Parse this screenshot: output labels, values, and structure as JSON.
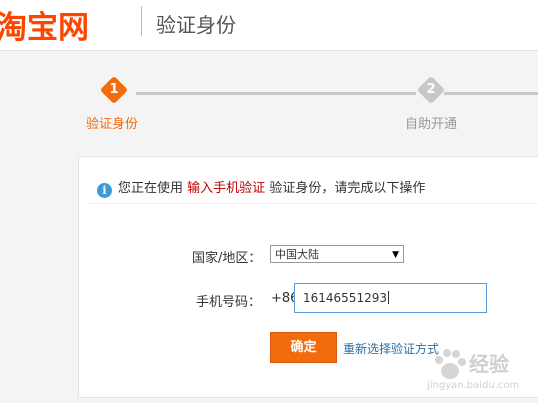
{
  "header": {
    "logo": "淘宝网",
    "title": "验证身份"
  },
  "steps": [
    {
      "number": "1",
      "label": "验证身份",
      "state": "active"
    },
    {
      "number": "2",
      "label": "自助开通",
      "state": "inactive"
    }
  ],
  "colors": {
    "brand": "#ff4400",
    "active_step": "#f26b0c",
    "inactive_step": "#c8c8c8",
    "highlight": "#c40000",
    "link": "#2e6da4",
    "button": "#f26b0c",
    "info_icon": "#3d9ad9"
  },
  "notice": {
    "icon": "info-icon",
    "prefix": "您正在使用",
    "method": "输入手机验证",
    "suffix": "验证身份，请完成以下操作"
  },
  "form": {
    "region_label": "国家/地区：",
    "region_value": "中国大陆",
    "phone_label": "手机号码：",
    "phone_prefix": "+86",
    "phone_value": "16146551293",
    "confirm_label": "确定",
    "reselect_link": "重新选择验证方式"
  },
  "watermark": {
    "text_main": "经验",
    "text_sub": "jingyan.baidu.com"
  }
}
